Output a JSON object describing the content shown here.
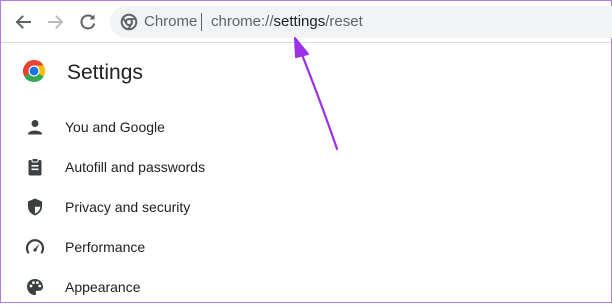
{
  "browser": {
    "omnibox": {
      "chip_label": "Chrome",
      "url_scheme": "chrome://",
      "url_host": "settings",
      "url_path": "/reset"
    }
  },
  "settings": {
    "title": "Settings",
    "menu": [
      {
        "label": "You and Google",
        "icon": "person-icon"
      },
      {
        "label": "Autofill and passwords",
        "icon": "clipboard-icon"
      },
      {
        "label": "Privacy and security",
        "icon": "shield-icon"
      },
      {
        "label": "Performance",
        "icon": "speedometer-icon"
      },
      {
        "label": "Appearance",
        "icon": "palette-icon"
      }
    ]
  },
  "colors": {
    "annotation_arrow": "#9b30e8",
    "frame_border": "#b07be6",
    "icon_gray": "#5f6368"
  }
}
